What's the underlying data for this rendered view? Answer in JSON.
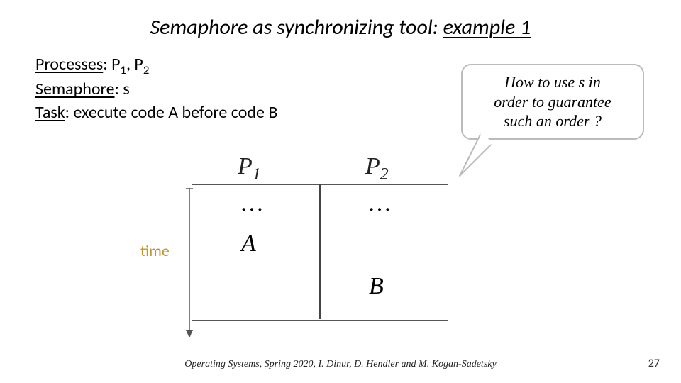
{
  "title": {
    "prefix": "Semaphore as synchronizing tool: ",
    "underlined": "example 1"
  },
  "defs": {
    "processes_label": "Processes",
    "processes_text": ": P",
    "processes_sub1": "1",
    "processes_mid": ", P",
    "processes_sub2": "2",
    "semaphore_label": "Semaphore",
    "semaphore_text": ": s",
    "task_label": "Task",
    "task_text": ": execute code A before code B"
  },
  "callout": {
    "line1": "How to use s in",
    "line2": "order to guarantee",
    "line3": "such an order ?"
  },
  "diagram": {
    "time_label": "time",
    "p1_label": "P",
    "p1_sub": "1",
    "p2_label": "P",
    "p2_sub": "2",
    "dots": "…",
    "codeA": "A",
    "codeB": "B"
  },
  "footer": "Operating Systems, Spring 2020, I. Dinur, D. Hendler and M. Kogan-Sadetsky",
  "page_number": "27"
}
